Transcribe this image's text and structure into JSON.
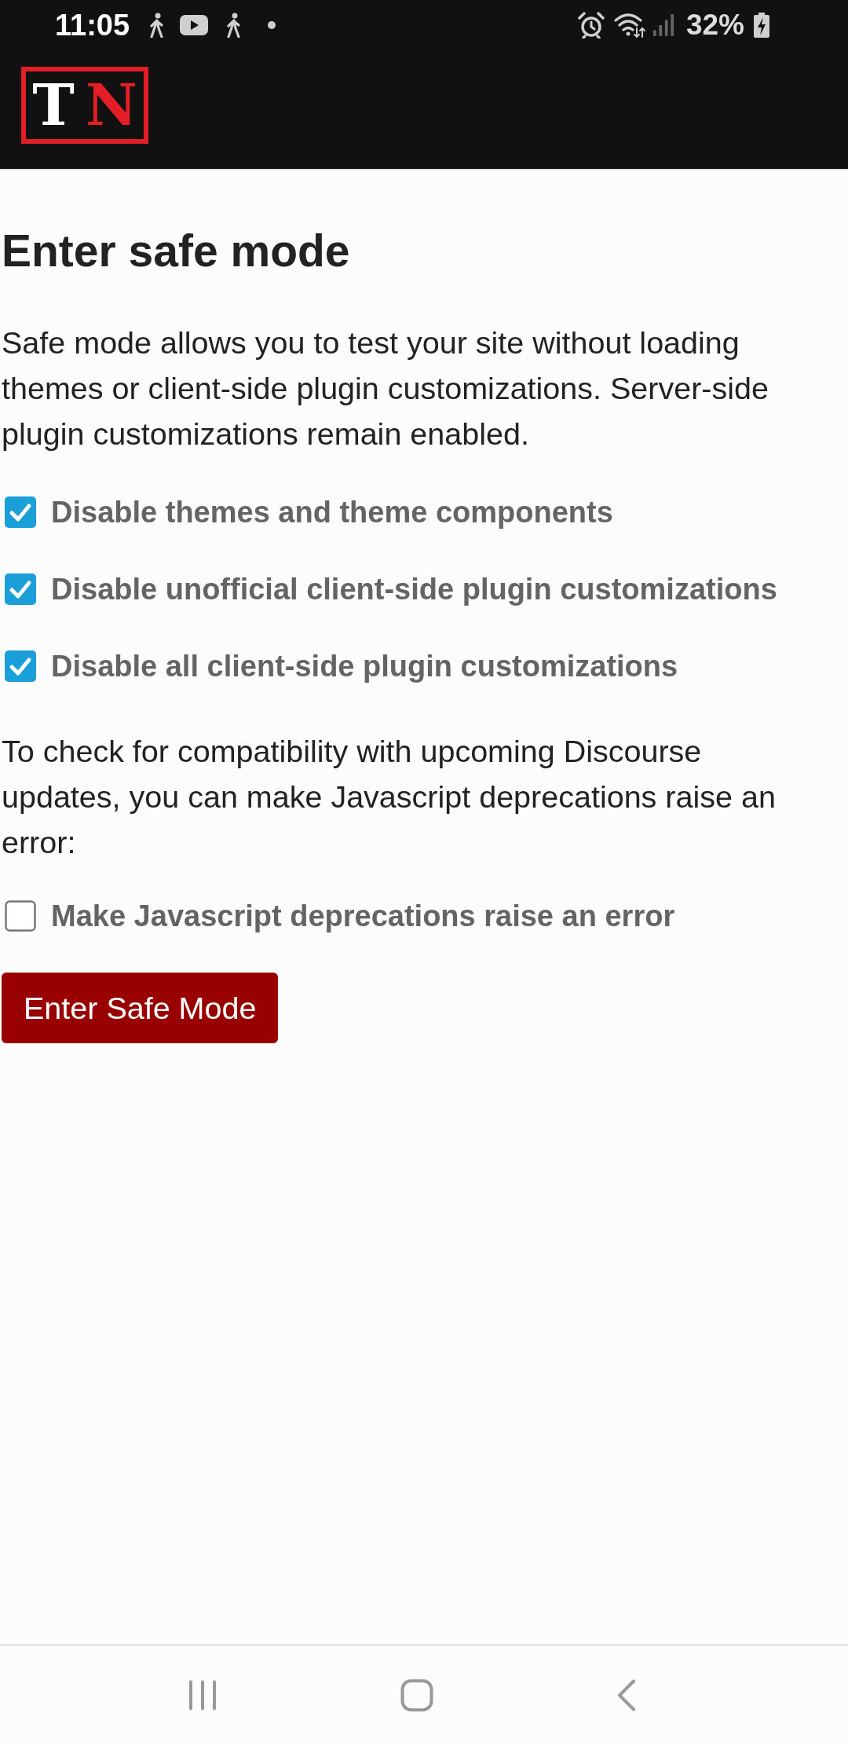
{
  "status_bar": {
    "time": "11:05",
    "battery": "32%"
  },
  "header": {
    "logo": [
      {
        "text": "T",
        "color": "#ffffff"
      },
      {
        "text": "N",
        "color": "#e41e26"
      }
    ]
  },
  "page": {
    "title": "Enter safe mode",
    "intro": "Safe mode allows you to test your site without loading themes or client-side plugin customizations. Server-side plugin customizations remain enabled.",
    "options": [
      {
        "label": "Disable themes and theme components",
        "checked": true
      },
      {
        "label": "Disable unofficial client-side plugin customizations",
        "checked": true
      },
      {
        "label": "Disable all client-side plugin customizations",
        "checked": true
      }
    ],
    "note": "To check for compatibility with upcoming Discourse updates, you can make Javascript deprecations raise an error:",
    "extra_options": [
      {
        "label": "Make Javascript deprecations raise an error",
        "checked": false
      }
    ],
    "button": "Enter Safe Mode"
  }
}
